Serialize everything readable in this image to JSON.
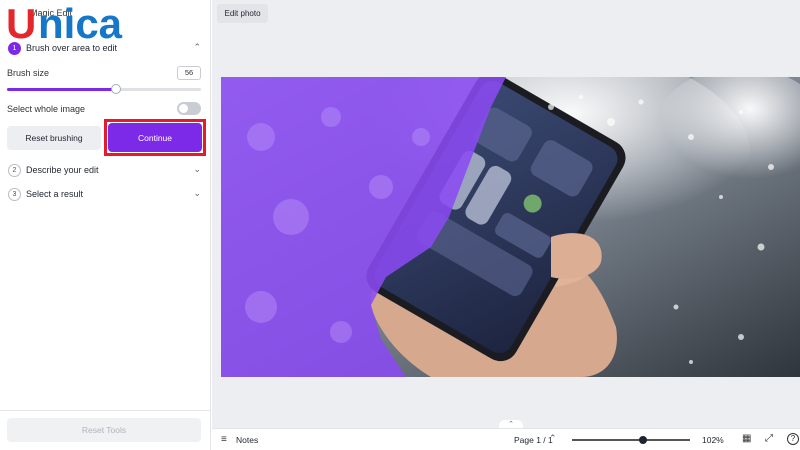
{
  "app": {
    "brand_logo": "Unica",
    "panel_title": "Magic Edit"
  },
  "steps": [
    {
      "num": "1",
      "label": "Brush over area to edit",
      "state": "active",
      "chevron": "chevron-up-icon"
    },
    {
      "num": "2",
      "label": "Describe your edit",
      "state": "idle",
      "chevron": "chevron-down-icon"
    },
    {
      "num": "3",
      "label": "Select a result",
      "state": "idle",
      "chevron": "chevron-down-icon"
    }
  ],
  "brush": {
    "label": "Brush size",
    "value": "56",
    "slider_fraction": 0.56
  },
  "whole_image": {
    "label": "Select whole image",
    "enabled": false
  },
  "buttons": {
    "reset_brushing": "Reset brushing",
    "continue": "Continue",
    "reset_tools": "Reset Tools",
    "edit_photo": "Edit photo"
  },
  "bottom_bar": {
    "notes": "Notes",
    "page": "Page 1 / 1",
    "zoom": "102%",
    "zoom_fraction": 0.6
  },
  "colors": {
    "accent": "#7d2ae8",
    "highlight": "#e21b2e",
    "brush_overlay": "#8a4af3",
    "logo_blue": "#1677c9",
    "logo_red": "#e4262d"
  }
}
